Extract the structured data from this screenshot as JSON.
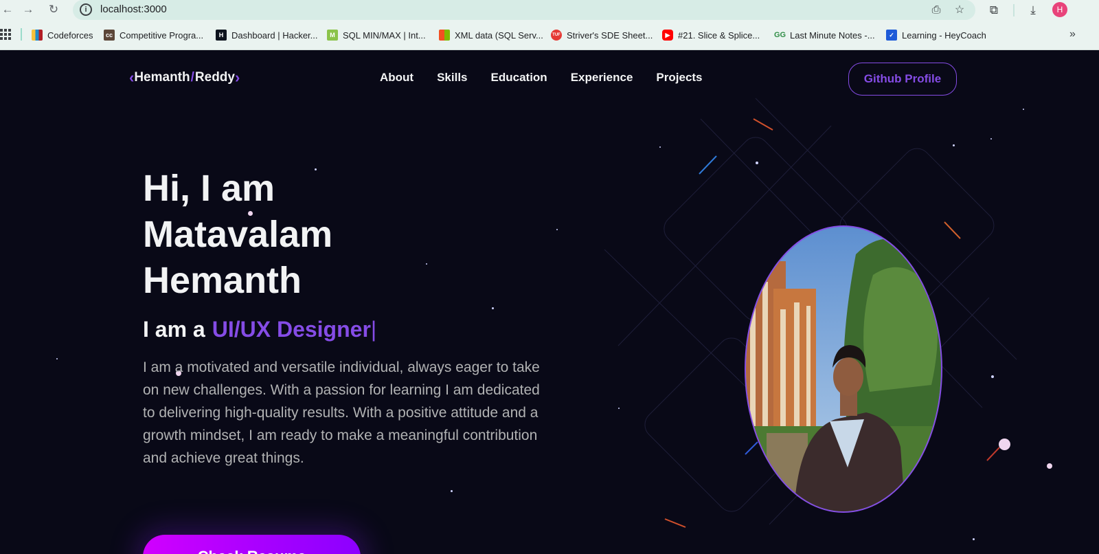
{
  "browser": {
    "url": "localhost:3000",
    "profile_initial": "H",
    "bookmarks": [
      {
        "label": "Codeforces",
        "icon": "codeforces-icon",
        "color": "#1f8acb"
      },
      {
        "label": "Competitive Progra...",
        "icon": "cc-icon",
        "color": "#5b4638"
      },
      {
        "label": "Dashboard | Hacker...",
        "icon": "hackerrank-icon",
        "color": "#0e141e"
      },
      {
        "label": "SQL MIN/MAX | Int...",
        "icon": "sql-icon",
        "color": "#8bc34a"
      },
      {
        "label": "XML data (SQL Serv...",
        "icon": "microsoft-icon",
        "color": "#f25022"
      },
      {
        "label": "Striver's SDE Sheet...",
        "icon": "tuf-icon",
        "color": "#e53935"
      },
      {
        "label": "#21. Slice & Splice...",
        "icon": "youtube-icon",
        "color": "#ff0000"
      },
      {
        "label": "Last Minute Notes -...",
        "icon": "gfg-icon",
        "color": "#2f8d46"
      },
      {
        "label": "Learning - HeyCoach",
        "icon": "heycoach-icon",
        "color": "#1e5bd8"
      }
    ]
  },
  "page": {
    "logo": {
      "left": "Hemanth",
      "slash": "/",
      "right": "Reddy"
    },
    "nav": [
      "About",
      "Skills",
      "Education",
      "Experience",
      "Projects"
    ],
    "github_button": "Github Profile",
    "hero": {
      "line1": "Hi, I am",
      "line2": "Matavalam",
      "line3": "Hemanth",
      "role_prefix": "I am a",
      "role": "UI/UX Designer",
      "cursor": "|",
      "description": "I am a motivated and versatile individual, always eager to take on new challenges. With a passion for learning I am dedicated to delivering high-quality results. With a positive attitude and a growth mindset, I am ready to make a meaningful contribution and achieve great things.",
      "cta": "Check Resume"
    }
  },
  "colors": {
    "accent": "#854ce6",
    "background": "#090917",
    "text": "#f2f3f4",
    "muted": "#b1b2b3"
  }
}
